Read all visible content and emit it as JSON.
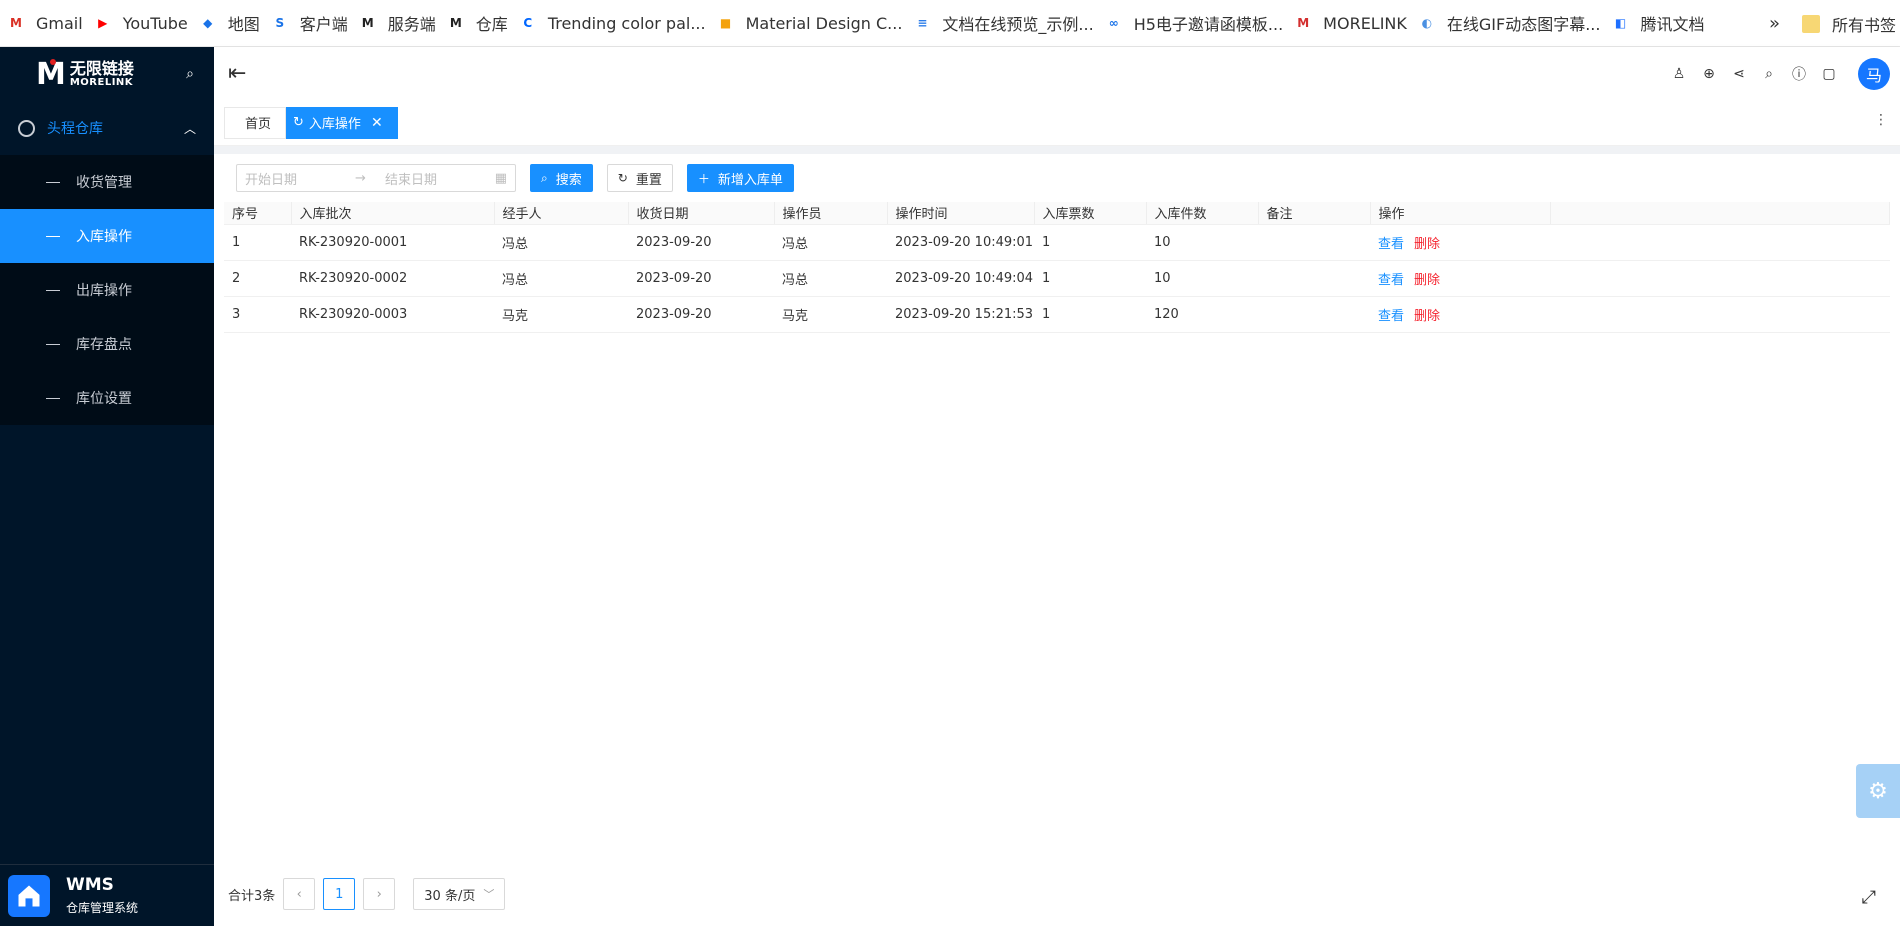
{
  "bookmarks": [
    {
      "label": "Gmail",
      "icon": "gmail-icon",
      "glyph": "M",
      "color": "#d93025"
    },
    {
      "label": "YouTube",
      "icon": "youtube-icon",
      "glyph": "▶",
      "color": "#ff0000"
    },
    {
      "label": "地图",
      "icon": "maps-icon",
      "glyph": "◆",
      "color": "#1a73e8"
    },
    {
      "label": "客户端",
      "icon": "client-icon",
      "glyph": "S",
      "color": "#1a73e8"
    },
    {
      "label": "服务端",
      "icon": "morelink-icon",
      "glyph": "M",
      "color": "#222222"
    },
    {
      "label": "仓库",
      "icon": "morelink-icon",
      "glyph": "M",
      "color": "#222222"
    },
    {
      "label": "Trending color pal...",
      "icon": "coolors-icon",
      "glyph": "C",
      "color": "#0066ff"
    },
    {
      "label": "Material Design C...",
      "icon": "material-icon",
      "glyph": "■",
      "color": "#f4a20c"
    },
    {
      "label": "文档在线预览_示例...",
      "icon": "doc-icon",
      "glyph": "≡",
      "color": "#2b7de9"
    },
    {
      "label": "H5电子邀请函模板...",
      "icon": "h5-icon",
      "glyph": "∞",
      "color": "#1a73e8"
    },
    {
      "label": "MORELINK",
      "icon": "morelink-red-icon",
      "glyph": "M",
      "color": "#d32f2f"
    },
    {
      "label": "在线GIF动态图字幕...",
      "icon": "gif-icon",
      "glyph": "◐",
      "color": "#4a90e2"
    },
    {
      "label": "腾讯文档",
      "icon": "tencent-docs-icon",
      "glyph": "◧",
      "color": "#1e6fff"
    }
  ],
  "bookmarks_more": "»",
  "bookmarks_all": "所有书签",
  "sidebar": {
    "logo_cn": "无限链接",
    "logo_en": "MORELINK",
    "group_label": "头程仓库",
    "items": [
      {
        "label": "收货管理",
        "active": false
      },
      {
        "label": "入库操作",
        "active": true
      },
      {
        "label": "出库操作",
        "active": false
      },
      {
        "label": "库存盘点",
        "active": false
      },
      {
        "label": "库位设置",
        "active": false
      }
    ],
    "footer_title": "WMS",
    "footer_subtitle": "仓库管理系统"
  },
  "header": {
    "avatar_text": "马"
  },
  "tabs": [
    {
      "label": "首页",
      "active": false
    },
    {
      "label": "入库操作",
      "active": true
    }
  ],
  "filters": {
    "start_placeholder": "开始日期",
    "end_placeholder": "结束日期",
    "search_label": "搜索",
    "reset_label": "重置",
    "add_label": "新增入库单"
  },
  "table": {
    "columns": [
      "序号",
      "入库批次",
      "经手人",
      "收货日期",
      "操作员",
      "操作时间",
      "入库票数",
      "入库件数",
      "备注",
      "操作"
    ],
    "rows": [
      [
        "1",
        "RK-230920-0001",
        "冯总",
        "2023-09-20",
        "冯总",
        "2023-09-20 10:49:01",
        "1",
        "10",
        ""
      ],
      [
        "2",
        "RK-230920-0002",
        "冯总",
        "2023-09-20",
        "冯总",
        "2023-09-20 10:49:04",
        "1",
        "10",
        ""
      ],
      [
        "3",
        "RK-230920-0003",
        "马克",
        "2023-09-20",
        "马克",
        "2023-09-20 15:21:53",
        "1",
        "120",
        ""
      ]
    ],
    "action_view": "查看",
    "action_delete": "删除"
  },
  "pagination": {
    "total_text": "合计3条",
    "current_page": "1",
    "page_size": "30 条/页"
  },
  "colors": {
    "primary": "#1890ff",
    "sidebar_bg": "#001529",
    "danger": "#f5222d"
  }
}
